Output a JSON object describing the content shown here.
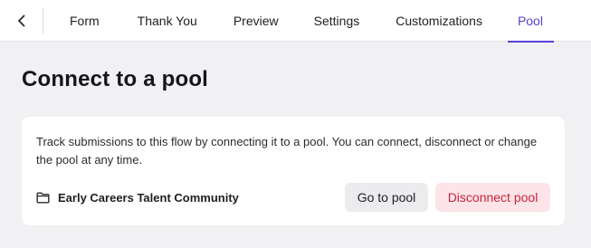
{
  "nav": {
    "back_icon": "chevron-left-icon",
    "tabs": [
      {
        "label": "Form"
      },
      {
        "label": "Thank You"
      },
      {
        "label": "Preview"
      },
      {
        "label": "Settings"
      },
      {
        "label": "Customizations"
      },
      {
        "label": "Pool",
        "active": true
      }
    ],
    "accent_color": "#5b3fd6"
  },
  "main": {
    "title": "Connect to a pool",
    "card": {
      "description": "Track submissions to this flow by connecting it to a pool. You can connect, disconnect or change the pool at any time.",
      "pool": {
        "icon": "folder-icon",
        "name": "Early Careers Talent Community"
      },
      "buttons": {
        "go_to_pool": "Go to pool",
        "disconnect": "Disconnect pool"
      }
    }
  }
}
